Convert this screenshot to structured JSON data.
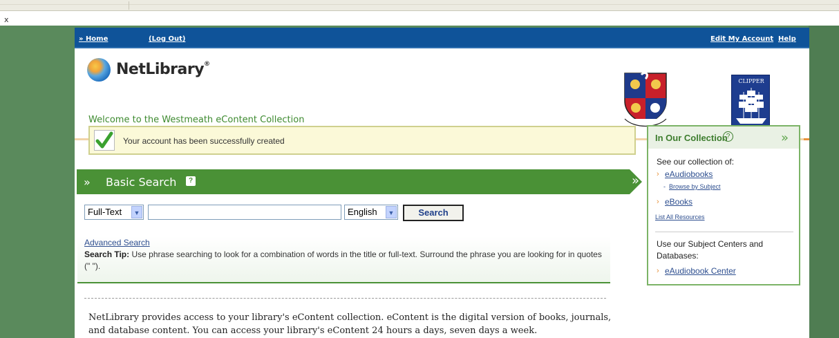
{
  "browser": {
    "close_mark": "x"
  },
  "nav": {
    "home": "» Home",
    "logout": "(Log Out)",
    "edit_account": "Edit My Account",
    "help": "Help"
  },
  "header": {
    "brand": "NetLibrary",
    "brand_suffix": "®",
    "welcome": "Welcome to the Westmeath eContent Collection",
    "crest_icon": "county-crest-icon",
    "clipper_label": "CLIPPER"
  },
  "notice": {
    "message": "Your account has been successfully created"
  },
  "search": {
    "title": "Basic Search",
    "help_glyph": "?",
    "scope_selected": "Full-Text",
    "query_value": "",
    "language_selected": "English",
    "button_label": "Search",
    "advanced_link": "Advanced Search",
    "tip_label": "Search Tip:",
    "tip_text": " Use phrase searching to look for a combination of words in the title or full-text. Surround the phrase you are looking for in quotes (\" \")."
  },
  "intro": {
    "text": "NetLibrary provides access to your library's eContent collection. eContent is the digital version of books, journals, and database content. You can access your library's eContent 24 hours a days, seven days a week."
  },
  "sidebar": {
    "title": "In Our Collection",
    "help_glyph": "?",
    "see_text": "See our collection of:",
    "eaudiobooks": "eAudiobooks",
    "browse_prefix": "- ",
    "browse_subject": "Browse by Subject",
    "ebooks": "eBooks",
    "list_all": "List All Resources",
    "subject_text": "Use our Subject Centers and Databases:",
    "eaudiobook_center": "eAudiobook Center"
  },
  "colors": {
    "nav_blue": "#0f5399",
    "search_green": "#4a9136",
    "welcome_green": "#3d8a2f",
    "page_bg_green": "#5a8a5c"
  }
}
